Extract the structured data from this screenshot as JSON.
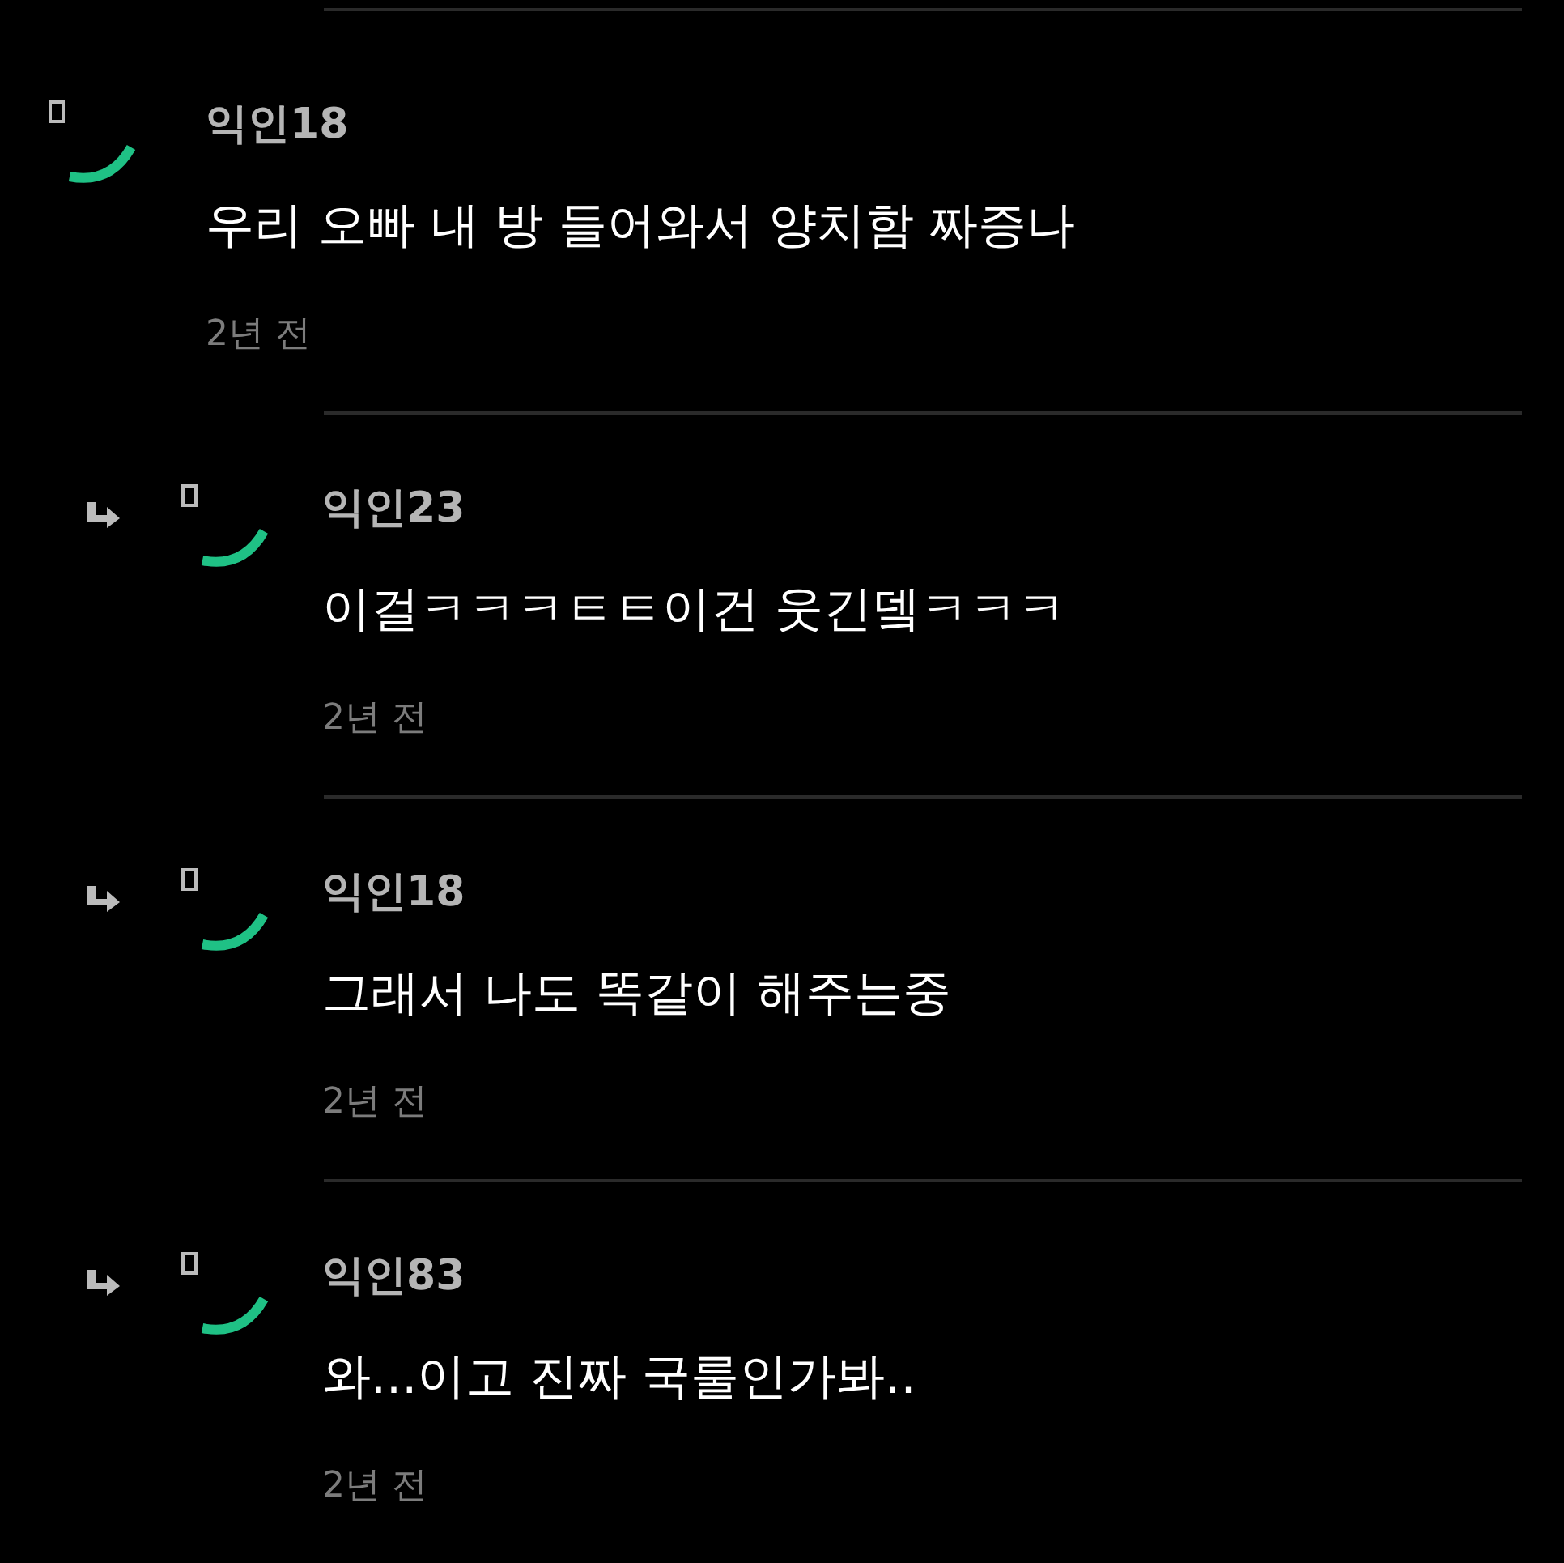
{
  "comments": [
    {
      "author": "익인18",
      "text": "우리 오빠 내 방 들어와서 양치함 짜증나",
      "time": "2년 전",
      "children": [
        {
          "author": "익인23",
          "text": "이걸ㅋㅋㅋㅌㅌ이건 웃긴뎈ㅋㅋㅋ",
          "time": "2년 전"
        },
        {
          "author": "익인18",
          "text": "그래서 나도 똑같이 해주는중",
          "time": "2년 전"
        },
        {
          "author": "익인83",
          "text": "와...이고 진짜 국룰인가봐..",
          "time": "2년 전"
        }
      ]
    }
  ]
}
